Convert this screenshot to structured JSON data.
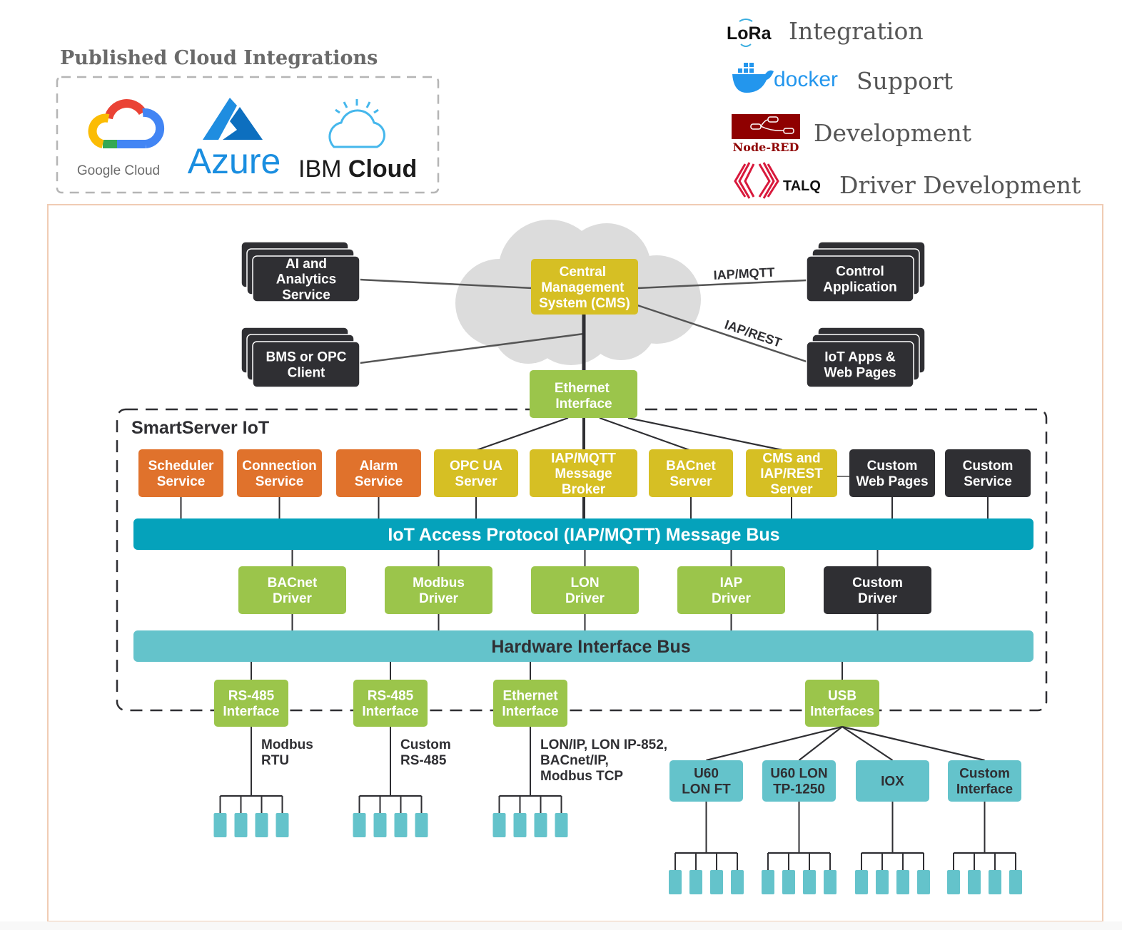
{
  "header": {
    "cloud_integrations_title": "Published Cloud Integrations",
    "cloud_logos": [
      {
        "name": "Google Cloud",
        "icon": "google-cloud-icon"
      },
      {
        "name": "Azure",
        "icon": "azure-icon"
      },
      {
        "name": "IBM Cloud",
        "icon": "ibm-cloud-icon",
        "prefix": "IBM",
        "suffix": "Cloud"
      }
    ],
    "features": [
      {
        "logo_text": "LoRa",
        "icon": "lora-icon",
        "label": "Integration"
      },
      {
        "logo_text": "docker",
        "icon": "docker-icon",
        "label": "Support"
      },
      {
        "logo_text": "Node-RED",
        "icon": "node-red-icon",
        "label": "Development"
      },
      {
        "logo_text": "TALQ",
        "icon": "talq-icon",
        "label": "Driver Development"
      }
    ]
  },
  "colors": {
    "dark": "#2f2f33",
    "orange": "#e0722c",
    "yellow": "#d6bf24",
    "green": "#9bc54b",
    "bus_blue": "#05a2bb",
    "hw_blue": "#64c3cb",
    "cloud_gray": "#dcdcdc",
    "frame": "#f0ccb4"
  },
  "external": {
    "ai_service": [
      "AI and",
      "Analytics",
      "Service"
    ],
    "bms_client": [
      "BMS or OPC",
      "Client"
    ],
    "cms": [
      "Central",
      "Management",
      "System (CMS)"
    ],
    "control_app": [
      "Control",
      "Application"
    ],
    "iot_apps": [
      "IoT Apps &",
      "Web Pages"
    ],
    "ethernet_top": [
      "Ethernet",
      "Interface"
    ],
    "link_labels": {
      "mqtt": "IAP/MQTT",
      "rest": "IAP/REST"
    }
  },
  "smartserver": {
    "title": "SmartServer IoT",
    "services": [
      {
        "lines": [
          "Scheduler",
          "Service"
        ],
        "color": "orange"
      },
      {
        "lines": [
          "Connection",
          "Service"
        ],
        "color": "orange"
      },
      {
        "lines": [
          "Alarm",
          "Service"
        ],
        "color": "orange"
      },
      {
        "lines": [
          "OPC UA",
          "Server"
        ],
        "color": "yellow"
      },
      {
        "lines": [
          "IAP/MQTT",
          "Message",
          "Broker"
        ],
        "color": "yellow"
      },
      {
        "lines": [
          "BACnet",
          "Server"
        ],
        "color": "yellow"
      },
      {
        "lines": [
          "CMS and",
          "IAP/REST",
          "Server"
        ],
        "color": "yellow"
      },
      {
        "lines": [
          "Custom",
          "Web Pages"
        ],
        "color": "dark"
      },
      {
        "lines": [
          "Custom",
          "Service"
        ],
        "color": "dark"
      }
    ],
    "message_bus": "IoT Access Protocol (IAP/MQTT) Message Bus",
    "drivers": [
      {
        "lines": [
          "BACnet",
          "Driver"
        ],
        "color": "green"
      },
      {
        "lines": [
          "Modbus",
          "Driver"
        ],
        "color": "green"
      },
      {
        "lines": [
          "LON",
          "Driver"
        ],
        "color": "green"
      },
      {
        "lines": [
          "IAP",
          "Driver"
        ],
        "color": "green"
      },
      {
        "lines": [
          "Custom",
          "Driver"
        ],
        "color": "dark"
      }
    ],
    "hardware_bus": "Hardware Interface Bus",
    "interfaces": [
      {
        "lines": [
          "RS-485",
          "Interface"
        ],
        "protocol": [
          "Modbus",
          "RTU"
        ]
      },
      {
        "lines": [
          "RS-485",
          "Interface"
        ],
        "protocol": [
          "Custom",
          "RS-485"
        ]
      },
      {
        "lines": [
          "Ethernet",
          "Interface"
        ],
        "protocol": [
          "LON/IP, LON IP-852,",
          "BACnet/IP,",
          "Modbus TCP"
        ]
      },
      {
        "lines": [
          "USB",
          "Interfaces"
        ],
        "protocol": []
      }
    ],
    "usb_children": [
      {
        "lines": [
          "U60",
          "LON FT"
        ]
      },
      {
        "lines": [
          "U60 LON",
          "TP-1250"
        ]
      },
      {
        "lines": [
          "IOX"
        ]
      },
      {
        "lines": [
          "Custom",
          "Interface"
        ]
      }
    ],
    "devices_per_group": 4
  }
}
